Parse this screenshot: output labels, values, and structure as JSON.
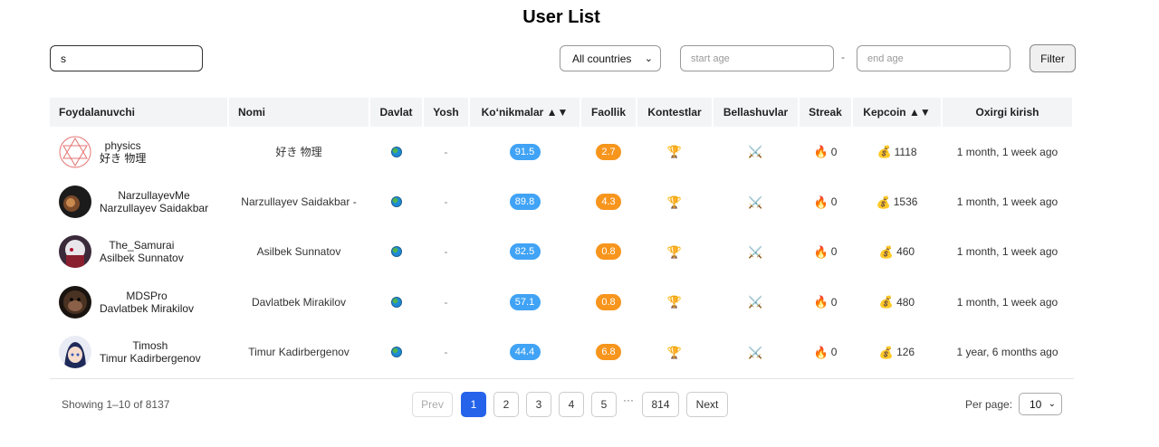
{
  "page": {
    "title": "User List"
  },
  "filters": {
    "search_value": "s",
    "country_selected": "All countries",
    "start_age_placeholder": "start age",
    "end_age_placeholder": "end age",
    "dash": "-",
    "filter_label": "Filter"
  },
  "table": {
    "headers": [
      "Foydalanuvchi",
      "Nomi",
      "Davlat",
      "Yosh",
      "Ko‘nikmalar ▲▼",
      "Faollik",
      "Kontestlar",
      "Bellashuvlar",
      "Streak",
      "Kepcoin ▲▼",
      "Oxirgi kirish"
    ],
    "rows": [
      {
        "username": "physics",
        "fullname": "好き 物理",
        "name": "好き 物理",
        "age": "-",
        "skills": "91.5",
        "activity": "2.7",
        "streak": "0",
        "kepcoin": "1118",
        "last_login": "1 month, 1 week ago",
        "avatar": "star-of-david-avatar"
      },
      {
        "username": "NarzullayevMe",
        "fullname": "Narzullayev Saidakbar",
        "name": "Narzullayev Saidakbar -",
        "age": "-",
        "skills": "89.8",
        "activity": "4.3",
        "streak": "0",
        "kepcoin": "1536",
        "last_login": "1 month, 1 week ago",
        "avatar": "dark-photo-avatar"
      },
      {
        "username": "The_Samurai",
        "fullname": "Asilbek Sunnatov",
        "name": "Asilbek Sunnatov",
        "age": "-",
        "skills": "82.5",
        "activity": "0.8",
        "streak": "0",
        "kepcoin": "460",
        "last_login": "1 month, 1 week ago",
        "avatar": "anime-avatar"
      },
      {
        "username": "MDSPro",
        "fullname": "Davlatbek Mirakilov",
        "name": "Davlatbek Mirakilov",
        "age": "-",
        "skills": "57.1",
        "activity": "0.8",
        "streak": "0",
        "kepcoin": "480",
        "last_login": "1 month, 1 week ago",
        "avatar": "monkey-avatar"
      },
      {
        "username": "Timosh",
        "fullname": "Timur Kadirbergenov",
        "name": "Timur Kadirbergenov",
        "age": "-",
        "skills": "44.4",
        "activity": "6.8",
        "streak": "0",
        "kepcoin": "126",
        "last_login": "1 year, 6 months ago",
        "avatar": "anime-girl-avatar"
      }
    ]
  },
  "footer": {
    "showing": "Showing 1–10 of 8137",
    "prev": "Prev",
    "pages": [
      "1",
      "2",
      "3",
      "4",
      "5"
    ],
    "ellipsis": "···",
    "last_page": "814",
    "next": "Next",
    "per_page_label": "Per page:",
    "per_page_value": "10"
  },
  "colors": {
    "accent": "#2563eb",
    "skill_badge": "#40a3f5",
    "activity_badge": "#f7951d"
  }
}
